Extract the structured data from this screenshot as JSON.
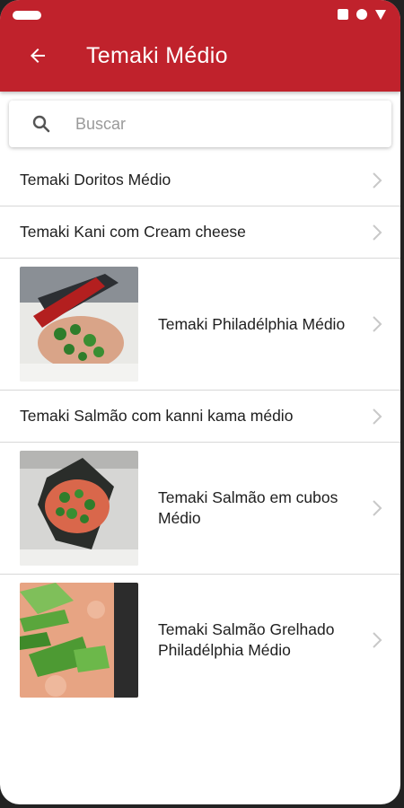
{
  "header": {
    "title": "Temaki Médio",
    "back_icon": "arrow-left-icon"
  },
  "search": {
    "placeholder": "Buscar",
    "icon": "search-icon"
  },
  "colors": {
    "app_bar": "#c0222c",
    "text": "#202020",
    "divider": "#d8d8d8",
    "chevron": "#c8c8c8"
  },
  "items": [
    {
      "label": "Temaki Doritos Médio",
      "has_image": false
    },
    {
      "label": "Temaki Kani com Cream cheese",
      "has_image": false
    },
    {
      "label": "Temaki Philadélphia Médio",
      "has_image": true
    },
    {
      "label": "Temaki Salmão com kanni kama médio",
      "has_image": false
    },
    {
      "label": "Temaki Salmão em cubos Médio",
      "has_image": true
    },
    {
      "label": "Temaki Salmão Grelhado Philadélphia Médio",
      "has_image": true
    }
  ]
}
